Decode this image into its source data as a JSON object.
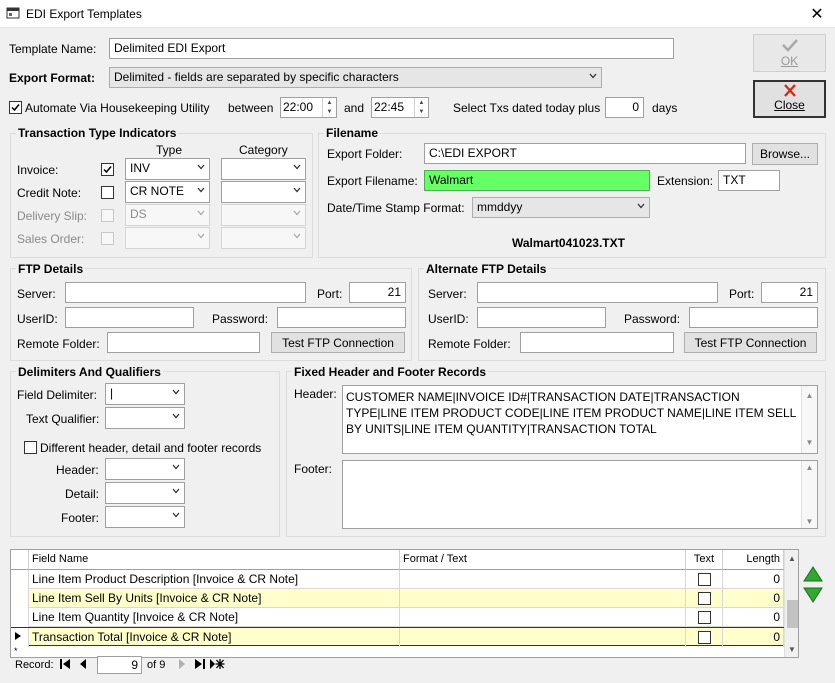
{
  "window": {
    "title": "EDI Export Templates",
    "close_glyph": "✕"
  },
  "template_name": {
    "label": "Template Name:",
    "value": "Delimited EDI Export"
  },
  "export_format": {
    "label": "Export Format:",
    "value": "Delimited - fields are separated by specific characters"
  },
  "automate": {
    "label": "Automate Via Housekeeping Utility",
    "checked": true,
    "between_label": "between",
    "start": "22:00",
    "and_label": "and",
    "end": "22:45",
    "select_label": "Select Txs dated today plus",
    "days_value": "0",
    "days_label": "days"
  },
  "buttons": {
    "ok": "OK",
    "close": "Close",
    "browse": "Browse...",
    "test_ftp": "Test FTP Connection",
    "test_alt_ftp": "Test FTP Connection"
  },
  "transaction_types": {
    "title": "Transaction Type Indicators",
    "type_header": "Type",
    "category_header": "Category",
    "rows": [
      {
        "label": "Invoice:",
        "checked": true,
        "type": "INV",
        "category": "",
        "enabled": true
      },
      {
        "label": "Credit Note:",
        "checked": false,
        "type": "CR NOTE",
        "category": "",
        "enabled": true
      },
      {
        "label": "Delivery Slip:",
        "checked": false,
        "type": "DS",
        "category": "",
        "enabled": false
      },
      {
        "label": "Sales Order:",
        "checked": false,
        "type": "",
        "category": "",
        "enabled": false
      }
    ]
  },
  "filename": {
    "title": "Filename",
    "folder_label": "Export Folder:",
    "folder_value": "C:\\EDI EXPORT",
    "file_label": "Export Filename:",
    "file_value": "Walmart",
    "ext_label": "Extension:",
    "ext_value": "TXT",
    "stamp_label": "Date/Time Stamp Format:",
    "stamp_value": "mmddyy",
    "preview": "Walmart041023.TXT"
  },
  "ftp": {
    "title": "FTP Details",
    "server_label": "Server:",
    "server_value": "",
    "port_label": "Port:",
    "port_value": "21",
    "user_label": "UserID:",
    "user_value": "",
    "pass_label": "Password:",
    "pass_value": "",
    "folder_label": "Remote Folder:",
    "folder_value": ""
  },
  "alt_ftp": {
    "title": "Alternate FTP Details",
    "server_label": "Server:",
    "server_value": "",
    "port_label": "Port:",
    "port_value": "21",
    "user_label": "UserID:",
    "user_value": "",
    "pass_label": "Password:",
    "pass_value": "",
    "folder_label": "Remote Folder:",
    "folder_value": ""
  },
  "delimiters": {
    "title": "Delimiters And Qualifiers",
    "field_label": "Field Delimiter:",
    "field_value": "|",
    "text_label": "Text Qualifier:",
    "text_value": "",
    "different_label": "Different header, detail and footer records",
    "different_checked": false,
    "header_label": "Header:",
    "detail_label": "Detail:",
    "footer_label": "Footer:"
  },
  "records": {
    "title": "Fixed Header and Footer Records",
    "header_label": "Header:",
    "header_value": "CUSTOMER NAME|INVOICE ID#|TRANSACTION DATE|TRANSACTION TYPE|LINE ITEM PRODUCT CODE|LINE ITEM PRODUCT NAME|LINE ITEM SELL BY UNITS|LINE ITEM QUANTITY|TRANSACTION TOTAL",
    "footer_label": "Footer:",
    "footer_value": ""
  },
  "grid": {
    "columns": [
      "Field Name",
      "Format / Text",
      "Text",
      "Length"
    ],
    "rows": [
      {
        "name": "Line Item Product Description [Invoice & CR Note]",
        "format": "",
        "length": "0",
        "highlight": false,
        "current": false
      },
      {
        "name": "Line Item Sell By Units [Invoice & CR Note]",
        "format": "",
        "length": "0",
        "highlight": true,
        "current": false
      },
      {
        "name": "Line Item Quantity [Invoice & CR Note]",
        "format": "",
        "length": "0",
        "highlight": false,
        "current": false
      },
      {
        "name": "Transaction Total [Invoice & CR Note]",
        "format": "",
        "length": "0",
        "highlight": true,
        "current": true
      }
    ]
  },
  "nav": {
    "label": "Record:",
    "current": "9",
    "of": "of 9"
  }
}
